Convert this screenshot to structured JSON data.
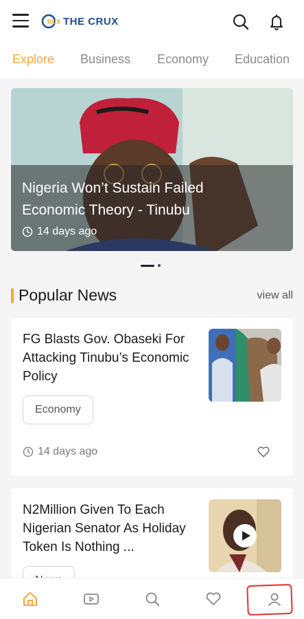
{
  "header": {
    "logo_text": "THE CRUX",
    "logo_mark_text": "RUX",
    "icons": [
      "hamburger-menu-icon",
      "search-icon",
      "bell-icon"
    ]
  },
  "tabs": [
    {
      "label": "Explore",
      "active": true
    },
    {
      "label": "Business",
      "active": false
    },
    {
      "label": "Economy",
      "active": false
    },
    {
      "label": "Education",
      "active": false
    }
  ],
  "hero": {
    "title": "Nigeria Won’t Sustain Failed Economic Theory - Tinubu",
    "time": "14 days ago"
  },
  "carousel": {
    "slides": 2,
    "active_index": 0
  },
  "popular": {
    "title": "Popular News",
    "view_all": "view all",
    "items": [
      {
        "title": "FG Blasts Gov. Obaseki For Attacking Tinubu’s Economic Policy",
        "tag": "Economy",
        "time": "14 days ago",
        "has_video": false
      },
      {
        "title": "N2Million Given To Each Nigerian Senator As Holiday Token Is Nothing ...",
        "tag": "News",
        "time": "",
        "has_video": true
      }
    ]
  },
  "bottom_nav": [
    "home-icon",
    "video-icon",
    "search-icon",
    "heart-icon",
    "profile-icon"
  ],
  "colors": {
    "accent": "#f2a93b",
    "brand": "#1d4f8f",
    "highlight_box": "#e13030"
  }
}
